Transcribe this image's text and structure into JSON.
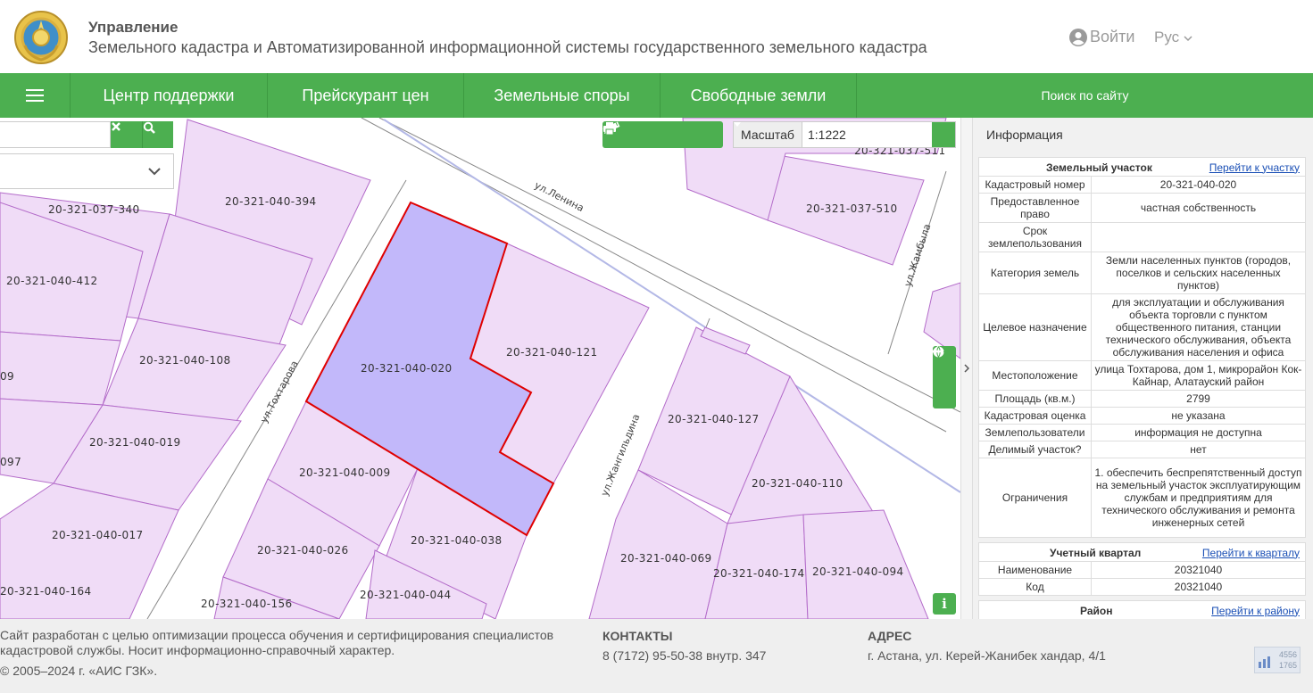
{
  "header": {
    "title_line1": "Управление",
    "title_line2": "Земельного кадастра и Автоматизированной информационной системы государственного земельного кадастра",
    "login_label": "Войти",
    "language_label": "Рус"
  },
  "nav": {
    "items": [
      {
        "label": "Центр поддержки"
      },
      {
        "label": "Прейскурант цен"
      },
      {
        "label": "Земельные споры"
      },
      {
        "label": "Свободные земли"
      }
    ],
    "site_search_label": "Поиск по сайту"
  },
  "map": {
    "search_input_value": "",
    "scale_label": "Масштаб",
    "scale_value": "1:1222",
    "streets": [
      "ул.Ленина",
      "ул.Тохтарова",
      "ул.Жангильдина",
      "ул.Жамбыла"
    ],
    "selected_parcel": "20-321-040-020",
    "parcels": [
      "20-321-040-394",
      "20-321-037-340",
      "20-321-040-412",
      "20-321-040-108",
      "20-321-040-121",
      "20-321-040-019",
      "20-321-040-009",
      "20-321-040-017",
      "20-321-040-026",
      "20-321-040-038",
      "20-321-040-044",
      "20-321-040-156",
      "20-321-040-164",
      "20-321-040-127",
      "20-321-040-110",
      "20-321-040-069",
      "20-321-040-174",
      "20-321-040-094",
      "20-321-037-510",
      "20-321-037-511",
      "09",
      "097"
    ],
    "colors": {
      "parcel_fill": "#f0dcf7",
      "parcel_stroke": "#b36bc9",
      "selected_fill": "#c2b8fa",
      "selected_stroke": "#e00000",
      "accent": "#4caf50"
    }
  },
  "panel": {
    "title": "Информация",
    "land_plot": {
      "header": "Земельный участок",
      "link": "Перейти к участку",
      "rows": [
        {
          "key": "Кадастровый номер",
          "value": "20-321-040-020"
        },
        {
          "key": "Предоставленное право",
          "value": "частная собственность"
        },
        {
          "key": "Срок землепользования",
          "value": ""
        },
        {
          "key": "Категория земель",
          "value": "Земли населенных пунктов (городов, поселков и сельских населенных пунктов)"
        },
        {
          "key": "Целевое назначение",
          "value": "для эксплуатации и обслуживания объекта торговли с пунктом общественного питания, станции технического обслуживания, объекта обслуживания населения и офиса"
        },
        {
          "key": "Местоположение",
          "value": "улица Тохтарова, дом 1, микрорайон Кок-Кайнар, Алатауский район"
        },
        {
          "key": "Площадь (кв.м.)",
          "value": "2799"
        },
        {
          "key": "Кадастровая оценка",
          "value": "не указана"
        },
        {
          "key": "Землепользователи",
          "value": "информация не доступна"
        },
        {
          "key": "Делимый участок?",
          "value": "нет"
        },
        {
          "key": "Ограничения",
          "value": "1. обеспечить беспрепятственный доступ на земельный участок эксплуатирующим службам и предприятиям для технического обслуживания и ремонта инженерных сетей"
        }
      ]
    },
    "quarter": {
      "header": "Учетный квартал",
      "link": "Перейти к кварталу",
      "rows": [
        {
          "key": "Наименование",
          "value": "20321040"
        },
        {
          "key": "Код",
          "value": "20321040"
        }
      ]
    },
    "district": {
      "header": "Район",
      "link": "Перейти к району"
    }
  },
  "footer": {
    "about": "Сайт разработан с целью оптимизации процесса обучения и сертифицирования специалистов кадастровой службы. Носит информационно-справочный характер.",
    "copyright": "© 2005–2024 г. «АИС ГЗК».",
    "contacts_heading": "КОНТАКТЫ",
    "contacts_value": "8 (7172) 95-50-38 внутр. 347",
    "address_heading": "АДРЕС",
    "address_value": "г. Астана, ул. Керей-Жанибек хандар, 4/1",
    "counter_top": "4556",
    "counter_bottom": "1765"
  }
}
